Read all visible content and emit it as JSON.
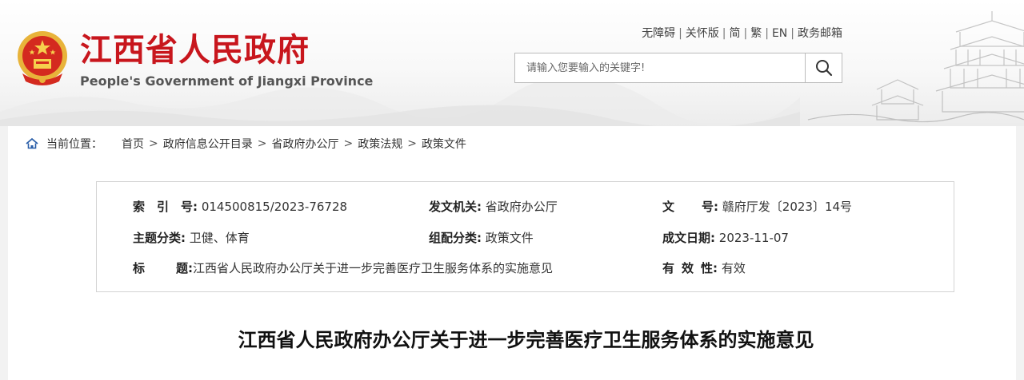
{
  "site": {
    "title_cn": "江西省人民政府",
    "title_en": "People's Government of Jiangxi Province"
  },
  "toplinks": [
    "无障碍",
    "关怀版",
    "简",
    "繁",
    "EN",
    "政务邮箱"
  ],
  "search": {
    "placeholder": "请输入您要输入的关键字!"
  },
  "breadcrumb": {
    "label": "当前位置：",
    "items": [
      "首页",
      "政府信息公开目录",
      "省政府办公厅",
      "政策法规",
      "政策文件"
    ],
    "separator": ">"
  },
  "info": {
    "index_label": "索  引  号:",
    "index_value": "014500815/2023-76728",
    "issuer_label": "发文机关:",
    "issuer_value": "省政府办公厅",
    "docno_label": "文      号:",
    "docno_value": "赣府厅发〔2023〕14号",
    "topic_label": "主题分类:",
    "topic_value": "卫健、体育",
    "category_label": "组配分类:",
    "category_value": "政策文件",
    "date_label": "成文日期:",
    "date_value": "2023-11-07",
    "title_label": "标      题:",
    "title_value": "江西省人民政府办公厅关于进一步完善医疗卫生服务体系的实施意见",
    "validity_label": "有  效  性:",
    "validity_value": "有效"
  },
  "article": {
    "title": "江西省人民政府办公厅关于进一步完善医疗卫生服务体系的实施意见"
  },
  "colors": {
    "brand_red": "#c8161d",
    "emblem_gold": "#e8b33a"
  }
}
